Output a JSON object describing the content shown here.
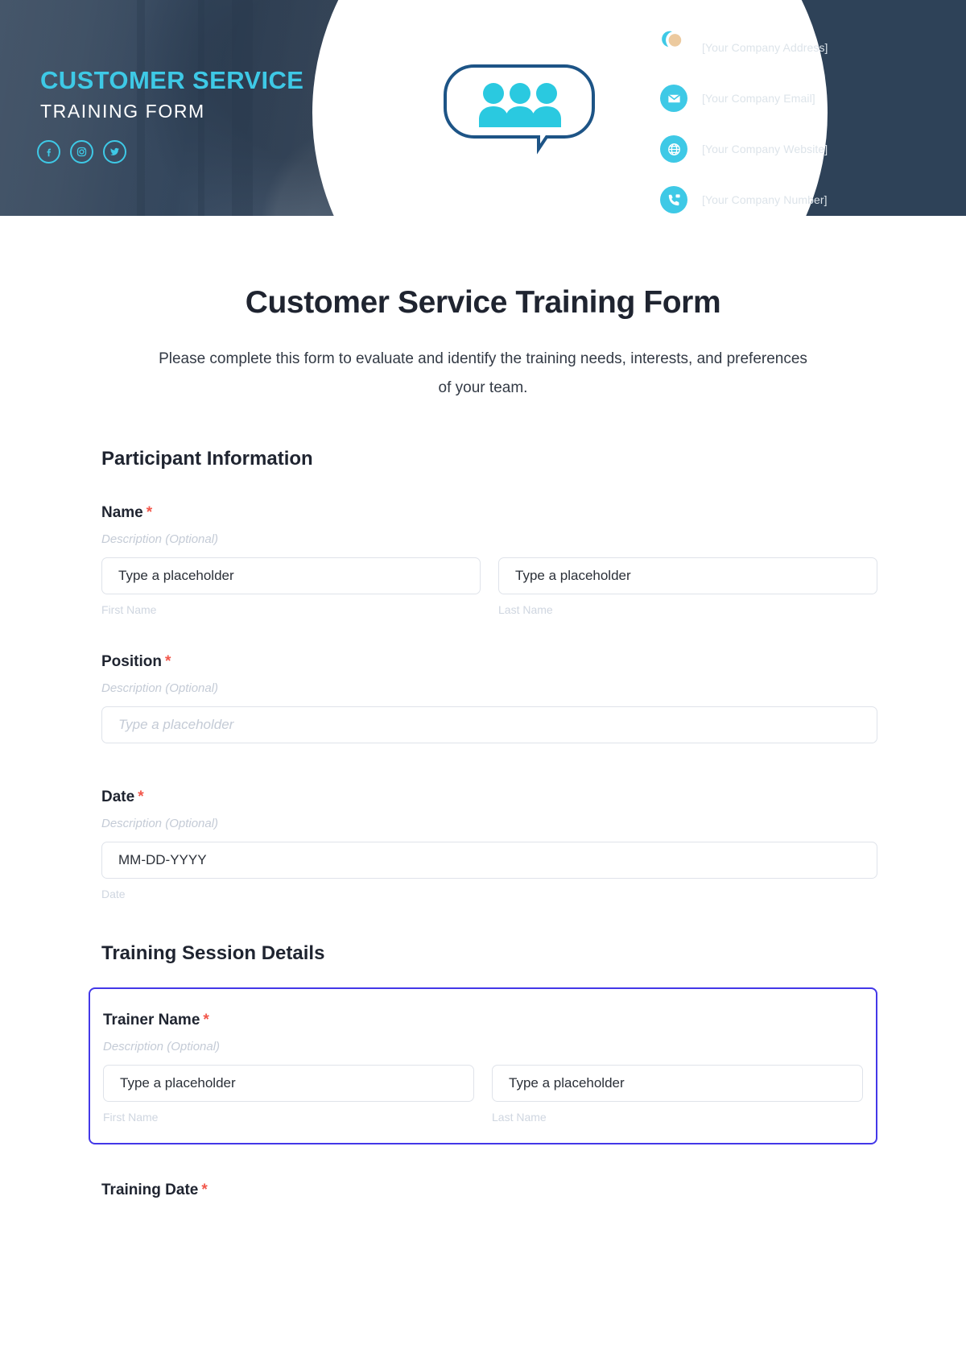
{
  "banner": {
    "title": "CUSTOMER SERVICE",
    "subtitle": "TRAINING FORM",
    "social": [
      {
        "name": "facebook-icon",
        "label": "Facebook"
      },
      {
        "name": "instagram-icon",
        "label": "Instagram"
      },
      {
        "name": "twitter-icon",
        "label": "Twitter"
      }
    ],
    "contacts": [
      {
        "icon": "location-pin-icon",
        "text": "[Your Company Address]"
      },
      {
        "icon": "email-icon",
        "text": "[Your Company Email]"
      },
      {
        "icon": "globe-icon",
        "text": "[Your Company Website]"
      },
      {
        "icon": "phone-icon",
        "text": "[Your Company Number]"
      }
    ],
    "logo_icon": "people-speech-bubble-icon",
    "colors": {
      "accent_cyan": "#3ec9e6",
      "navy": "#2e4258",
      "white": "#ffffff"
    }
  },
  "form": {
    "title": "Customer Service Training Form",
    "description": "Please complete this form to evaluate and identify the training needs, interests, and preferences of your team.",
    "required_marker": "*",
    "sections": [
      {
        "heading": "Participant Information",
        "fields": [
          {
            "label": "Name",
            "required": true,
            "description": "Description (Optional)",
            "inputs": [
              {
                "value": "Type a placeholder",
                "muted": false,
                "sublabel": "First Name"
              },
              {
                "value": "Type a placeholder",
                "muted": false,
                "sublabel": "Last Name"
              }
            ]
          },
          {
            "label": "Position",
            "required": true,
            "description": "Description (Optional)",
            "inputs": [
              {
                "value": "Type a placeholder",
                "muted": true,
                "sublabel": ""
              }
            ]
          },
          {
            "label": "Date",
            "required": true,
            "description": "Description (Optional)",
            "inputs": [
              {
                "value": "MM-DD-YYYY",
                "muted": false,
                "sublabel": "Date"
              }
            ]
          }
        ]
      },
      {
        "heading": "Training Session Details",
        "fields": [
          {
            "label": "Trainer Name",
            "required": true,
            "description": "Description (Optional)",
            "highlighted": true,
            "highlight_color": "#4338e8",
            "inputs": [
              {
                "value": "Type a placeholder",
                "muted": false,
                "sublabel": "First Name"
              },
              {
                "value": "Type a placeholder",
                "muted": false,
                "sublabel": "Last Name"
              }
            ]
          },
          {
            "label": "Training Date",
            "required": true,
            "description": "",
            "inputs": []
          }
        ]
      }
    ]
  }
}
